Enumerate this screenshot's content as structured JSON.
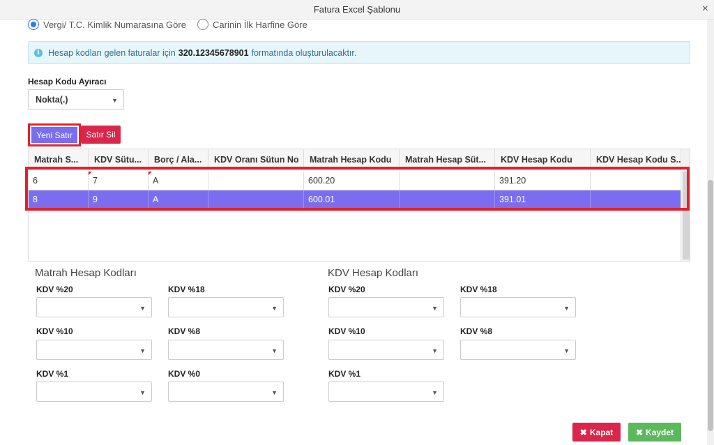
{
  "window": {
    "title": "Fatura Excel Şablonu",
    "close_glyph": "×"
  },
  "radio_options": [
    {
      "label": "Vergi/ T.C. Kimlik Numarasına Göre",
      "selected": true
    },
    {
      "label": "Carinin İlk Harfine Göre",
      "selected": false
    }
  ],
  "info": {
    "icon": "i",
    "prefix": "Hesap kodları gelen faturalar için",
    "example": "320.12345678901",
    "suffix": "formatında oluşturulacaktır."
  },
  "separator": {
    "label": "Hesap Kodu Ayıracı",
    "value": "Nokta(.)"
  },
  "buttons": {
    "new_row": "Yeni Satır",
    "delete_row": "Satır Sil",
    "close": "Kapat",
    "save": "Kaydet"
  },
  "grid": {
    "columns": [
      "Matrah S...",
      "KDV Sütu...",
      "Borç / Ala...",
      "KDV Oranı Sütun No",
      "Matrah Hesap Kodu",
      "Matrah Hesap Süt...",
      "KDV Hesap Kodu",
      "KDV Hesap Kodu S..."
    ],
    "rows": [
      {
        "cells": [
          "6",
          "7",
          "A",
          "",
          "600.20",
          "",
          "391.20",
          ""
        ],
        "selected": false
      },
      {
        "cells": [
          "8",
          "9",
          "A",
          "",
          "600.01",
          "",
          "391.01",
          ""
        ],
        "selected": true
      }
    ]
  },
  "matrah": {
    "title": "Matrah Hesap Kodları",
    "fields": [
      "KDV %20",
      "KDV %18",
      "KDV %10",
      "KDV %8",
      "KDV %1",
      "KDV %0"
    ]
  },
  "kdv": {
    "title": "KDV Hesap Kodları",
    "fields": [
      "KDV %20",
      "KDV %18",
      "KDV %10",
      "KDV %8",
      "KDV %1"
    ]
  },
  "colors": {
    "accent": "#7b6df0",
    "danger": "#d9264a",
    "success": "#5cb85c",
    "highlight": "#e1222e",
    "info_bg": "#e7f6fb"
  },
  "icons": {
    "close_x": "times-icon",
    "check": "check-icon",
    "info": "info-icon",
    "caret": "caret-down-icon"
  }
}
